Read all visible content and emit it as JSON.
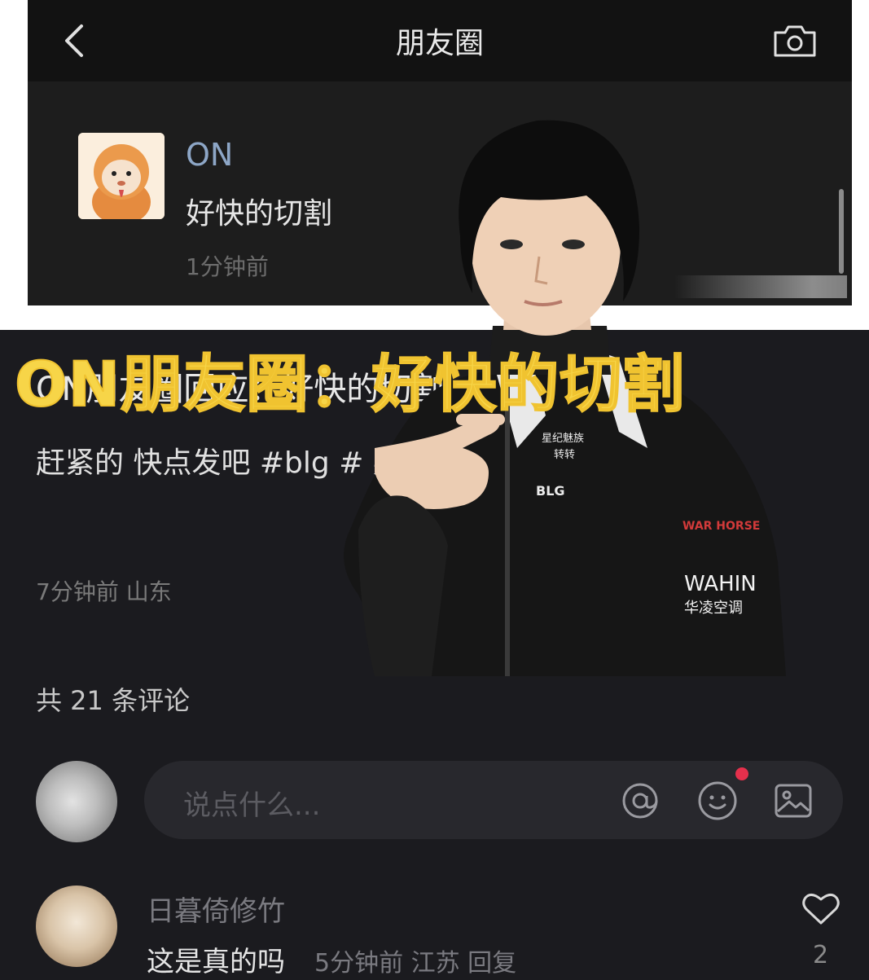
{
  "top": {
    "nav_title": "朋友圈",
    "user_name": "ON",
    "post_text": "好快的切割",
    "post_time": "1分钟前"
  },
  "post": {
    "title": "ON朋友圈回应：好快的切割",
    "body": "赶紧的 快点发吧 #blg #                        英雄联盟",
    "meta": "7分钟前 山东",
    "comment_count": "共 21 条评论"
  },
  "input": {
    "placeholder": "说点什么..."
  },
  "comment": {
    "user": "日暮倚修竹",
    "text": "这是真的吗",
    "meta": "5分钟前 江苏 回复",
    "likes": "2"
  },
  "jacket": {
    "brand_cn": "星纪魅族",
    "brand_cn2": "转转",
    "team": "BLG",
    "sponsor_war": "WAR HORSE",
    "sponsor_wahin": "WAHIN",
    "sponsor_wahin_cn": "华凌空调"
  },
  "caption": "ON朋友圈：好快的切割",
  "colors": {
    "caption": "#f7d548",
    "name_blue": "#8da6c6",
    "red_dot": "#e5304c"
  }
}
